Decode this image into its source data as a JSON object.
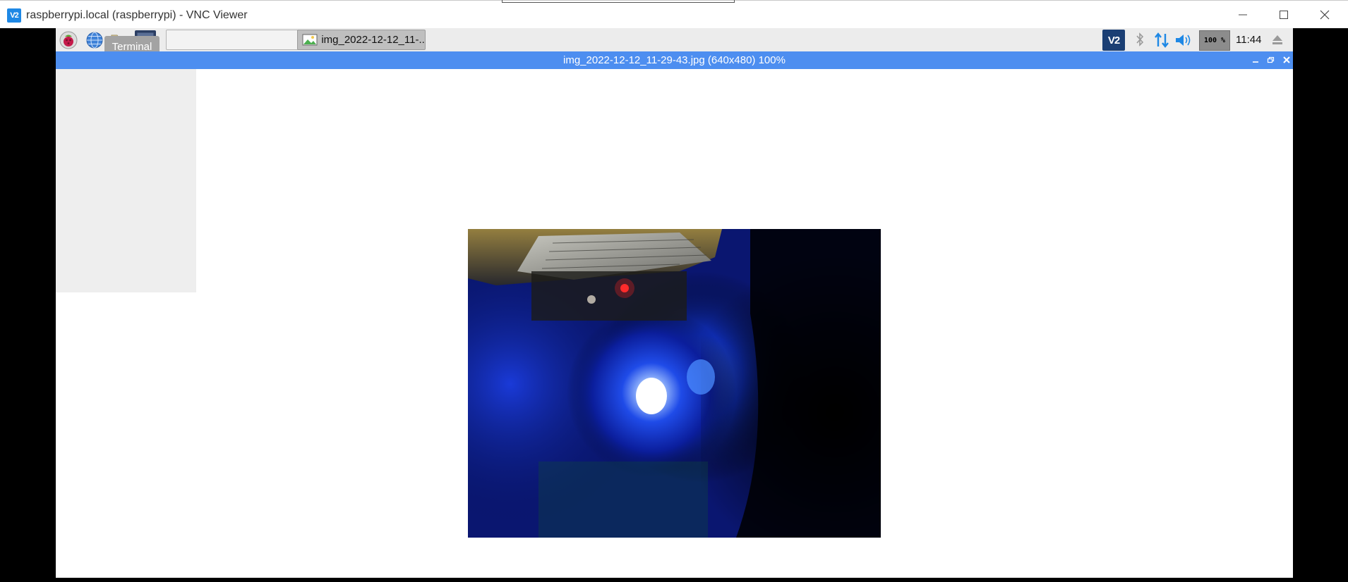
{
  "vnc_window": {
    "logo_text": "V2",
    "title": "raspberrypi.local (raspberrypi) - VNC Viewer"
  },
  "taskbar": {
    "icons": [
      "raspberry-menu-icon",
      "web-browser-icon",
      "file-manager-icon",
      "terminal-icon"
    ],
    "tooltip": "Terminal",
    "tasks": [
      {
        "label": "img_2022-12-12_11-..."
      }
    ],
    "tray": {
      "vnc_label": "V2",
      "cpu_usage": "100 %",
      "clock": "11:44"
    }
  },
  "image_viewer": {
    "title": "img_2022-12-12_11-29-43.jpg (640x480) 100%"
  },
  "colors": {
    "taskbar_bg": "#ececec",
    "viewer_titlebar": "#4d8ef0",
    "vnc_accent": "#1e88e5"
  }
}
